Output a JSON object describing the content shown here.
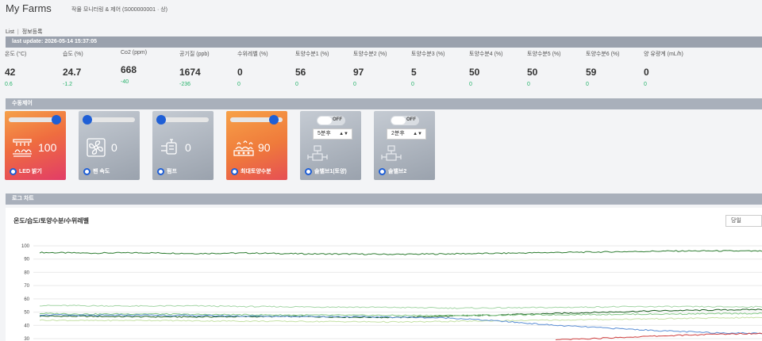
{
  "header": {
    "title": "My Farms",
    "subtitle": "작물 모니터링 & 제어 (S000000001 · 상)"
  },
  "nav": {
    "list": "List",
    "separator": "|",
    "register": "정보등록"
  },
  "update": {
    "text": "last update: 2026-05-14 15:37:05"
  },
  "sensors": [
    {
      "label": "온도 (°C)",
      "value": "42",
      "delta": "0.6"
    },
    {
      "label": "습도 (%)",
      "value": "24.7",
      "delta": "-1.2"
    },
    {
      "label": "Co2 (ppm)",
      "value": "668",
      "delta": "-40"
    },
    {
      "label": "공기질 (ppb)",
      "value": "1674",
      "delta": "-236"
    },
    {
      "label": "수위레벨 (%)",
      "value": "0",
      "delta": "0"
    },
    {
      "label": "토양수분1 (%)",
      "value": "56",
      "delta": "0"
    },
    {
      "label": "토양수분2 (%)",
      "value": "97",
      "delta": "0"
    },
    {
      "label": "토양수분3 (%)",
      "value": "5",
      "delta": "0"
    },
    {
      "label": "토양수분4 (%)",
      "value": "50",
      "delta": "0"
    },
    {
      "label": "토양수분5 (%)",
      "value": "50",
      "delta": "0"
    },
    {
      "label": "토양수분6 (%)",
      "value": "59",
      "delta": "0"
    },
    {
      "label": "양 유량계 (mL/h)",
      "value": "0",
      "delta": "0"
    }
  ],
  "manual": {
    "title": "수동제어"
  },
  "controls": {
    "led": {
      "name": "LED 밝기",
      "value": "100",
      "level": 1.0,
      "icon": "led-grow-light-icon"
    },
    "fan": {
      "name": "팬 속도",
      "value": "0",
      "level": 0.0,
      "icon": "fan-icon"
    },
    "pump": {
      "name": "펌프",
      "value": "0",
      "level": 0.0,
      "icon": "pump-icon"
    },
    "soil": {
      "name": "최대토양수분",
      "value": "90",
      "level": 0.9,
      "icon": "soil-moisture-icon"
    },
    "valve1": {
      "name": "솔밸브1(토양)",
      "toggle": "OFF",
      "select": "5분후",
      "icon": "valve-icon"
    },
    "valve2": {
      "name": "솔밸브2",
      "toggle": "OFF",
      "select": "2분후",
      "icon": "valve-icon"
    }
  },
  "log": {
    "title": "로그 차트"
  },
  "chart": {
    "title": "온도/습도/토양수분/수위레벨",
    "range": "당일"
  },
  "colors": {
    "accent": "#1f5fd6",
    "positive": "#27b36b",
    "bar": "#a9b0bb"
  },
  "chart_data": {
    "type": "line",
    "title": "온도/습도/토양수분/수위레벨",
    "ylim": [
      30,
      100
    ],
    "yticks": [
      "100",
      "90",
      "80",
      "70",
      "60",
      "50",
      "40",
      "30"
    ],
    "grid": true,
    "series": [
      {
        "color": "#2e7d32",
        "values": [
          95,
          94.5,
          94.8,
          94.2,
          94.6,
          94,
          93.8,
          93.6,
          94,
          94.4,
          95,
          95.4,
          96,
          96.2,
          96
        ]
      },
      {
        "color": "#1b5e20",
        "values": [
          47,
          46.8,
          46.5,
          46.4,
          46.6,
          46.7,
          46.2,
          46,
          47,
          48,
          49,
          50,
          51,
          51.5,
          52
        ]
      },
      {
        "color": "#a5d6a7",
        "values": [
          55,
          54.8,
          54.5,
          54.7,
          54.2,
          54,
          53.8,
          53.5,
          53,
          53.2,
          53.5,
          54,
          54.2,
          54,
          54
        ]
      },
      {
        "color": "#81c784",
        "values": [
          49,
          48.5,
          48.7,
          48.2,
          48,
          47.8,
          47.6,
          47.5,
          47.5,
          47.8,
          48,
          48.3,
          48.5,
          48.8,
          49
        ]
      },
      {
        "color": "#c5e1a5",
        "values": [
          44,
          43.6,
          43.8,
          43.4,
          43.2,
          43,
          42.8,
          42.5,
          43,
          43.5,
          44,
          44.5,
          45,
          45.5,
          46
        ]
      },
      {
        "color": "#5c8fd6",
        "values": [
          48,
          47.5,
          47.8,
          47.4,
          47,
          46.8,
          46.5,
          46.2,
          45.5,
          43,
          40,
          38,
          36,
          34.5,
          34
        ]
      },
      {
        "color": "#d04040",
        "values": [
          null,
          null,
          null,
          null,
          null,
          null,
          null,
          null,
          null,
          null,
          29,
          30.5,
          32,
          33.2,
          34
        ]
      }
    ]
  }
}
